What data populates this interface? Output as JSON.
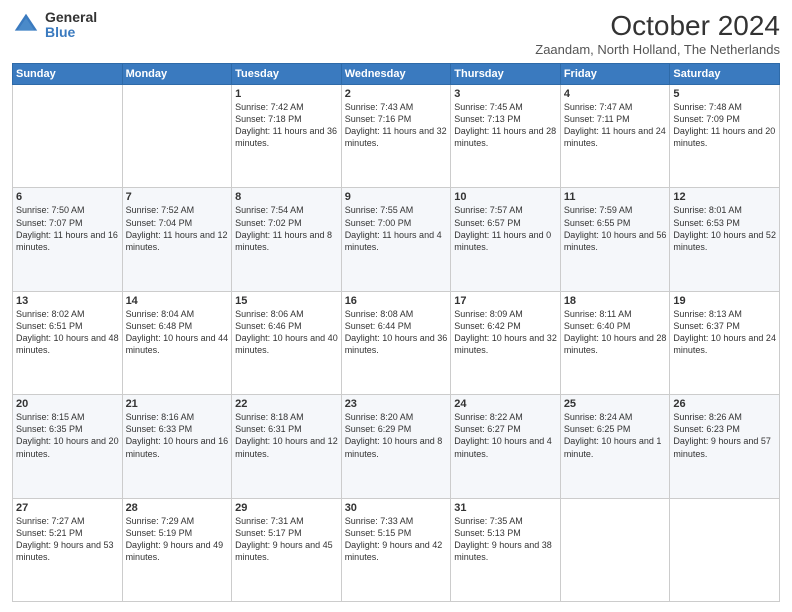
{
  "logo": {
    "general": "General",
    "blue": "Blue"
  },
  "header": {
    "month": "October 2024",
    "location": "Zaandam, North Holland, The Netherlands"
  },
  "days_of_week": [
    "Sunday",
    "Monday",
    "Tuesday",
    "Wednesday",
    "Thursday",
    "Friday",
    "Saturday"
  ],
  "weeks": [
    [
      {
        "day": "",
        "sunrise": "",
        "sunset": "",
        "daylight": ""
      },
      {
        "day": "",
        "sunrise": "",
        "sunset": "",
        "daylight": ""
      },
      {
        "day": "1",
        "sunrise": "Sunrise: 7:42 AM",
        "sunset": "Sunset: 7:18 PM",
        "daylight": "Daylight: 11 hours and 36 minutes."
      },
      {
        "day": "2",
        "sunrise": "Sunrise: 7:43 AM",
        "sunset": "Sunset: 7:16 PM",
        "daylight": "Daylight: 11 hours and 32 minutes."
      },
      {
        "day": "3",
        "sunrise": "Sunrise: 7:45 AM",
        "sunset": "Sunset: 7:13 PM",
        "daylight": "Daylight: 11 hours and 28 minutes."
      },
      {
        "day": "4",
        "sunrise": "Sunrise: 7:47 AM",
        "sunset": "Sunset: 7:11 PM",
        "daylight": "Daylight: 11 hours and 24 minutes."
      },
      {
        "day": "5",
        "sunrise": "Sunrise: 7:48 AM",
        "sunset": "Sunset: 7:09 PM",
        "daylight": "Daylight: 11 hours and 20 minutes."
      }
    ],
    [
      {
        "day": "6",
        "sunrise": "Sunrise: 7:50 AM",
        "sunset": "Sunset: 7:07 PM",
        "daylight": "Daylight: 11 hours and 16 minutes."
      },
      {
        "day": "7",
        "sunrise": "Sunrise: 7:52 AM",
        "sunset": "Sunset: 7:04 PM",
        "daylight": "Daylight: 11 hours and 12 minutes."
      },
      {
        "day": "8",
        "sunrise": "Sunrise: 7:54 AM",
        "sunset": "Sunset: 7:02 PM",
        "daylight": "Daylight: 11 hours and 8 minutes."
      },
      {
        "day": "9",
        "sunrise": "Sunrise: 7:55 AM",
        "sunset": "Sunset: 7:00 PM",
        "daylight": "Daylight: 11 hours and 4 minutes."
      },
      {
        "day": "10",
        "sunrise": "Sunrise: 7:57 AM",
        "sunset": "Sunset: 6:57 PM",
        "daylight": "Daylight: 11 hours and 0 minutes."
      },
      {
        "day": "11",
        "sunrise": "Sunrise: 7:59 AM",
        "sunset": "Sunset: 6:55 PM",
        "daylight": "Daylight: 10 hours and 56 minutes."
      },
      {
        "day": "12",
        "sunrise": "Sunrise: 8:01 AM",
        "sunset": "Sunset: 6:53 PM",
        "daylight": "Daylight: 10 hours and 52 minutes."
      }
    ],
    [
      {
        "day": "13",
        "sunrise": "Sunrise: 8:02 AM",
        "sunset": "Sunset: 6:51 PM",
        "daylight": "Daylight: 10 hours and 48 minutes."
      },
      {
        "day": "14",
        "sunrise": "Sunrise: 8:04 AM",
        "sunset": "Sunset: 6:48 PM",
        "daylight": "Daylight: 10 hours and 44 minutes."
      },
      {
        "day": "15",
        "sunrise": "Sunrise: 8:06 AM",
        "sunset": "Sunset: 6:46 PM",
        "daylight": "Daylight: 10 hours and 40 minutes."
      },
      {
        "day": "16",
        "sunrise": "Sunrise: 8:08 AM",
        "sunset": "Sunset: 6:44 PM",
        "daylight": "Daylight: 10 hours and 36 minutes."
      },
      {
        "day": "17",
        "sunrise": "Sunrise: 8:09 AM",
        "sunset": "Sunset: 6:42 PM",
        "daylight": "Daylight: 10 hours and 32 minutes."
      },
      {
        "day": "18",
        "sunrise": "Sunrise: 8:11 AM",
        "sunset": "Sunset: 6:40 PM",
        "daylight": "Daylight: 10 hours and 28 minutes."
      },
      {
        "day": "19",
        "sunrise": "Sunrise: 8:13 AM",
        "sunset": "Sunset: 6:37 PM",
        "daylight": "Daylight: 10 hours and 24 minutes."
      }
    ],
    [
      {
        "day": "20",
        "sunrise": "Sunrise: 8:15 AM",
        "sunset": "Sunset: 6:35 PM",
        "daylight": "Daylight: 10 hours and 20 minutes."
      },
      {
        "day": "21",
        "sunrise": "Sunrise: 8:16 AM",
        "sunset": "Sunset: 6:33 PM",
        "daylight": "Daylight: 10 hours and 16 minutes."
      },
      {
        "day": "22",
        "sunrise": "Sunrise: 8:18 AM",
        "sunset": "Sunset: 6:31 PM",
        "daylight": "Daylight: 10 hours and 12 minutes."
      },
      {
        "day": "23",
        "sunrise": "Sunrise: 8:20 AM",
        "sunset": "Sunset: 6:29 PM",
        "daylight": "Daylight: 10 hours and 8 minutes."
      },
      {
        "day": "24",
        "sunrise": "Sunrise: 8:22 AM",
        "sunset": "Sunset: 6:27 PM",
        "daylight": "Daylight: 10 hours and 4 minutes."
      },
      {
        "day": "25",
        "sunrise": "Sunrise: 8:24 AM",
        "sunset": "Sunset: 6:25 PM",
        "daylight": "Daylight: 10 hours and 1 minute."
      },
      {
        "day": "26",
        "sunrise": "Sunrise: 8:26 AM",
        "sunset": "Sunset: 6:23 PM",
        "daylight": "Daylight: 9 hours and 57 minutes."
      }
    ],
    [
      {
        "day": "27",
        "sunrise": "Sunrise: 7:27 AM",
        "sunset": "Sunset: 5:21 PM",
        "daylight": "Daylight: 9 hours and 53 minutes."
      },
      {
        "day": "28",
        "sunrise": "Sunrise: 7:29 AM",
        "sunset": "Sunset: 5:19 PM",
        "daylight": "Daylight: 9 hours and 49 minutes."
      },
      {
        "day": "29",
        "sunrise": "Sunrise: 7:31 AM",
        "sunset": "Sunset: 5:17 PM",
        "daylight": "Daylight: 9 hours and 45 minutes."
      },
      {
        "day": "30",
        "sunrise": "Sunrise: 7:33 AM",
        "sunset": "Sunset: 5:15 PM",
        "daylight": "Daylight: 9 hours and 42 minutes."
      },
      {
        "day": "31",
        "sunrise": "Sunrise: 7:35 AM",
        "sunset": "Sunset: 5:13 PM",
        "daylight": "Daylight: 9 hours and 38 minutes."
      },
      {
        "day": "",
        "sunrise": "",
        "sunset": "",
        "daylight": ""
      },
      {
        "day": "",
        "sunrise": "",
        "sunset": "",
        "daylight": ""
      }
    ]
  ]
}
